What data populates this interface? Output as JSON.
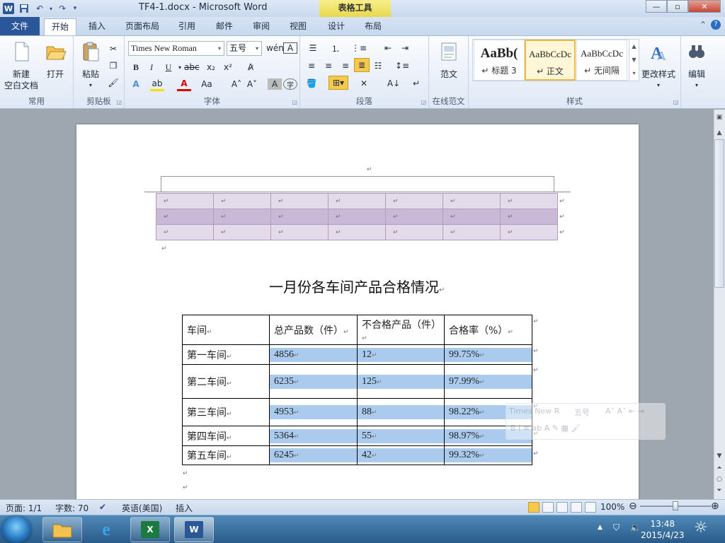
{
  "window": {
    "title": "TF4-1.docx - Microsoft Word",
    "context_tab": "表格工具",
    "minimize": "—",
    "maximize": "▫",
    "close": "✕"
  },
  "tabs": [
    "文件",
    "开始",
    "插入",
    "页面布局",
    "引用",
    "邮件",
    "审阅",
    "视图",
    "设计",
    "布局"
  ],
  "ribbon": {
    "common": {
      "label": "常用",
      "new_l1": "新建",
      "new_l2": "空白文档",
      "open": "打开"
    },
    "clipboard": {
      "label": "剪贴板",
      "paste": "粘贴"
    },
    "font": {
      "label": "字体",
      "font_name": "Times New Roman",
      "font_size": "五号"
    },
    "paragraph": {
      "label": "段落"
    },
    "online": {
      "label": "在线范文",
      "sample": "范文"
    },
    "styles": {
      "label": "样式",
      "items": [
        {
          "preview": "AaBb(",
          "name": "↵ 标题 3"
        },
        {
          "preview": "AaBbCcDc",
          "name": "↵ 正文"
        },
        {
          "preview": "AaBbCcDc",
          "name": "↵ 无间隔"
        }
      ],
      "change_styles": "更改样式"
    },
    "editing": {
      "label": "编辑"
    }
  },
  "document": {
    "heading": "一月份各车间产品合格情况",
    "table": {
      "headers": [
        "车间",
        "总产品数（件）",
        "不合格产品（件）",
        "合格率（%）"
      ],
      "rows": [
        [
          "第一车间",
          "4856",
          "12",
          "99.75%"
        ],
        [
          "第二车间",
          "6235",
          "125",
          "97.99%"
        ],
        [
          "第三车间",
          "4953",
          "88",
          "98.22%"
        ],
        [
          "第四车间",
          "5364",
          "55",
          "98.97%"
        ],
        [
          "第五车间",
          "6245",
          "42",
          "99.32%"
        ]
      ]
    },
    "para_mark": "↵",
    "ghost_toolbar_font": "Times New R",
    "ghost_toolbar_size": "五号"
  },
  "statusbar": {
    "page": "页面: 1/1",
    "words": "字数: 70",
    "language": "英语(美国)",
    "mode": "插入",
    "zoom": "100%",
    "zoom_level_pct": 100
  },
  "taskbar": {
    "time": "13:48",
    "date": "2015/4/23"
  },
  "colors": {
    "accent": "#2b579a",
    "cell_highlight": "#aacbee",
    "table_shade_light": "#e4dbea",
    "table_shade_dark": "#c9b8d6"
  }
}
